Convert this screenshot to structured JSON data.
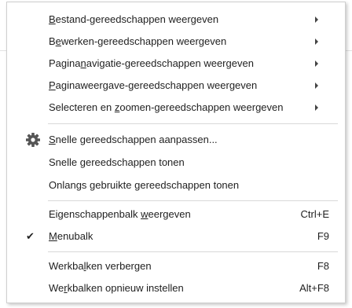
{
  "menu": {
    "groups": [
      {
        "items": [
          {
            "pre": "",
            "u": "B",
            "post": "estand-gereedschappen weergeven",
            "submenu": true
          },
          {
            "pre": "B",
            "u": "e",
            "post": "werken-gereedschappen weergeven",
            "submenu": true
          },
          {
            "pre": "Pagina",
            "u": "n",
            "post": "avigatie-gereedschappen weergeven",
            "submenu": true
          },
          {
            "pre": "",
            "u": "P",
            "post": "aginaweergave-gereedschappen weergeven",
            "submenu": true
          },
          {
            "pre": "Selecteren en ",
            "u": "z",
            "post": "oomen-gereedschappen weergeven",
            "submenu": true
          }
        ]
      },
      {
        "items": [
          {
            "pre": "",
            "u": "S",
            "post": "nelle gereedschappen aanpassen...",
            "icon": "gear-icon"
          },
          {
            "pre": "Snelle gereedschappen tonen",
            "u": "",
            "post": ""
          },
          {
            "pre": "Onlangs gebruikte gereedschappen tonen",
            "u": "",
            "post": ""
          }
        ]
      },
      {
        "items": [
          {
            "pre": "Eigenschappenbalk ",
            "u": "w",
            "post": "eergeven",
            "shortcut": "Ctrl+E"
          },
          {
            "pre": "",
            "u": "M",
            "post": "enubalk",
            "shortcut": "F9",
            "checked": true,
            "check_glyph": "✔"
          }
        ]
      },
      {
        "items": [
          {
            "pre": "Werkba",
            "u": "l",
            "post": "ken verbergen",
            "shortcut": "F8"
          },
          {
            "pre": "We",
            "u": "r",
            "post": "kbalken opnieuw instellen",
            "shortcut": "Alt+F8"
          }
        ]
      }
    ]
  }
}
